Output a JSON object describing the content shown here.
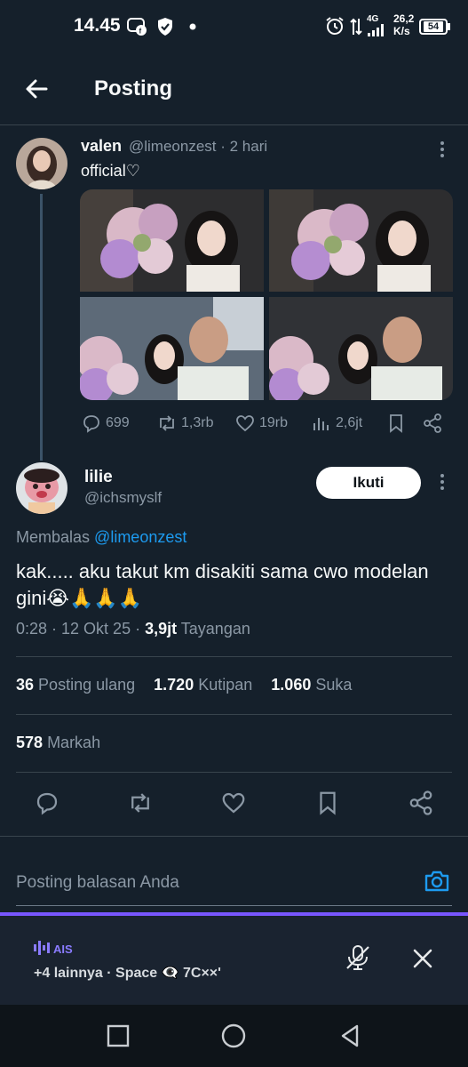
{
  "status_bar": {
    "time": "14.45",
    "network": "4G",
    "speed_value": "26,2",
    "speed_unit": "K/s",
    "battery": "54"
  },
  "header": {
    "title": "Posting"
  },
  "parent_tweet": {
    "name": "valen",
    "handle_time": "@limeonzest · 2 hari",
    "text": "official♡",
    "replies": "699",
    "reposts": "1,3rb",
    "likes": "19rb",
    "views": "2,6jt"
  },
  "reply_tweet": {
    "name": "lilie",
    "handle": "@ichsmyslf",
    "follow_label": "Ikuti",
    "replying_prefix": "Membalas",
    "replying_mention": "@limeonzest",
    "text": "kak..... aku takut km disakiti sama cwo modelan gini😭🙏🙏🙏",
    "time": "0:28 · 12 Okt 25 · ",
    "views_count": "3,9jt",
    "views_label": " Tayangan"
  },
  "stats": {
    "reposts_count": "36",
    "reposts_label": "Posting ulang",
    "quotes_count": "1.720",
    "quotes_label": "Kutipan",
    "likes_count": "1.060",
    "likes_label": "Suka",
    "bookmarks_count": "578",
    "bookmarks_label": "Markah"
  },
  "composer": {
    "placeholder": "Posting balasan Anda"
  },
  "spaces": {
    "live_label": "AIS",
    "title": "+4 lainnya · Space 👁‍🗨 7C××ʹ"
  },
  "colors": {
    "background": "#15202b",
    "accent": "#1d9bf0",
    "spaces_accent": "#7856ff"
  }
}
